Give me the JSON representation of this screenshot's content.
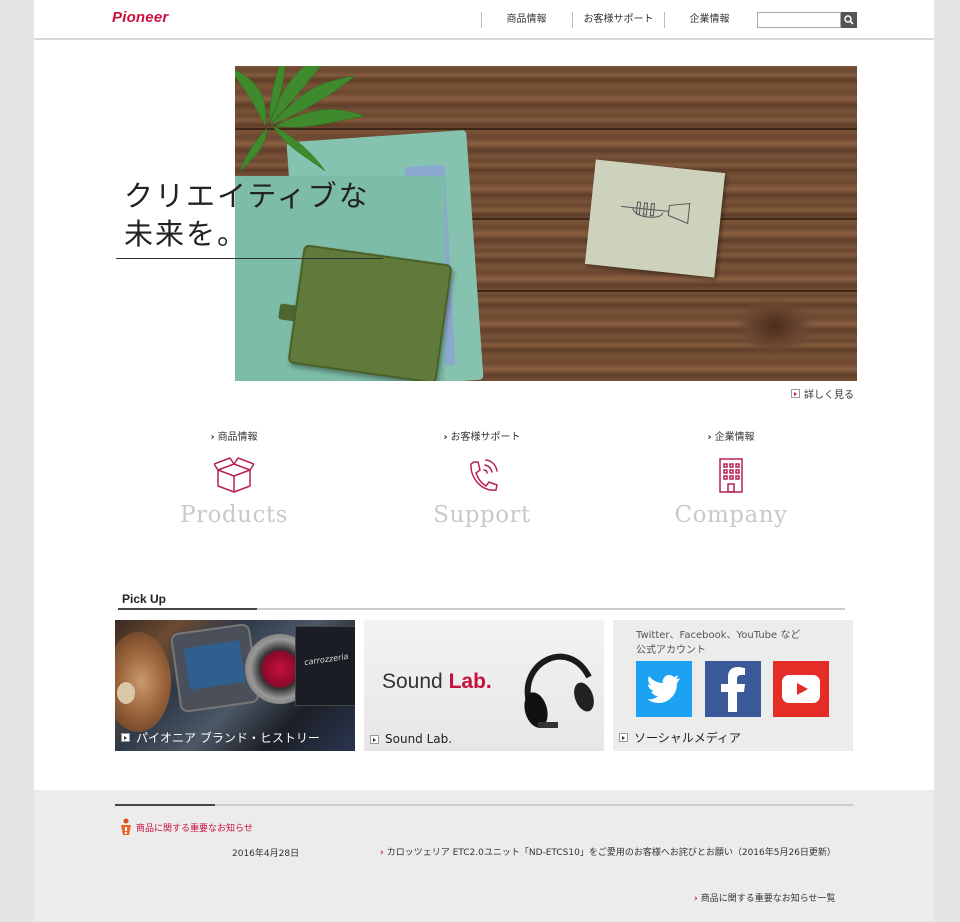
{
  "header": {
    "logo": "Pioneer",
    "nav": [
      "商品情報",
      "お客様サポート",
      "企業情報"
    ],
    "search": {
      "placeholder": "",
      "value": ""
    }
  },
  "hero": {
    "title_line1": "クリエイティブな",
    "title_line2": "未来を。",
    "more_label": "詳しく見る"
  },
  "categories": [
    {
      "label": "商品情報",
      "english": "Products",
      "icon": "box-icon"
    },
    {
      "label": "お客様サポート",
      "english": "Support",
      "icon": "phone-icon"
    },
    {
      "label": "企業情報",
      "english": "Company",
      "icon": "building-icon"
    }
  ],
  "pickup": {
    "title": "Pick Up",
    "items": [
      {
        "caption": "パイオニア ブランド・ヒストリー",
        "headunit_text": "carrozzeria"
      },
      {
        "caption": "Sound Lab.",
        "banner_text_1": "Sound",
        "banner_text_2": "Lab."
      },
      {
        "caption": "ソーシャルメディア",
        "intro_1": "Twitter、Facebook、YouTube など",
        "intro_2": "公式アカウント"
      }
    ]
  },
  "news": {
    "heading": "商品に関する重要なお知らせ",
    "date": "2016年4月28日",
    "text": "カロッツェリア ETC2.0ユニット「ND-ETCS10」をご愛用のお客様へお詫びとお願い（2016年5月26日更新）",
    "all_link": "商品に関する重要なお知らせ一覧"
  },
  "colors": {
    "brand": "#c8103e",
    "twitter": "#1da1f2",
    "facebook": "#3b5998",
    "youtube": "#e52d27"
  }
}
